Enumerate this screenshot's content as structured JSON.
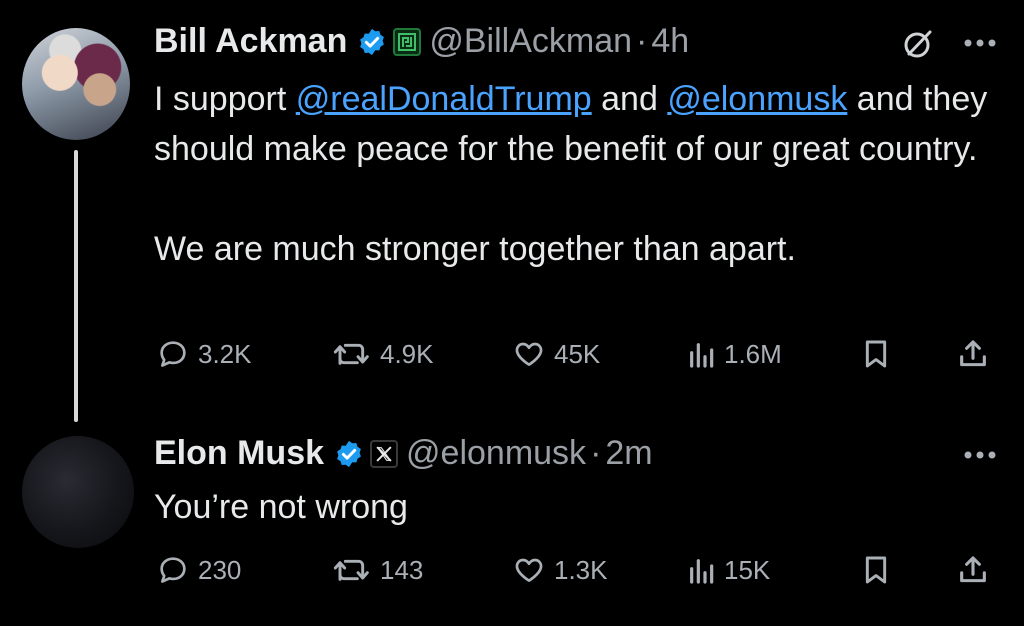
{
  "tweets": [
    {
      "author": {
        "name": "Bill Ackman",
        "handle": "@BillAckman",
        "time": "4h",
        "separator": "·"
      },
      "text": {
        "prefix": "I support ",
        "mention1": "@realDonaldTrump",
        "mid": " and ",
        "mention2": "@elonmusk",
        "rest": " and they should make peace for the benefit of our great country.",
        "para2": "We are much stronger together than apart."
      },
      "stats": {
        "replies": "3.2K",
        "reposts": "4.9K",
        "likes": "45K",
        "views": "1.6M"
      }
    },
    {
      "author": {
        "name": "Elon Musk",
        "handle": "@elonmusk",
        "time": "2m",
        "separator": "·"
      },
      "text": {
        "body": "You’re not wrong"
      },
      "stats": {
        "replies": "230",
        "reposts": "143",
        "likes": "1.3K",
        "views": "15K"
      }
    }
  ],
  "colors": {
    "background": "#000000",
    "text": "#e7e9ea",
    "secondary": "#9aa0a6",
    "link": "#4aa3ff",
    "verified": "#1d9bf0",
    "affiliate_green": "#1f7a3a"
  }
}
